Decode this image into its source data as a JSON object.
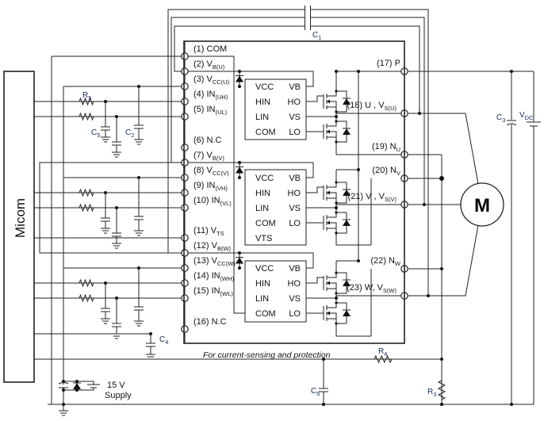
{
  "micom": {
    "label": "Micom"
  },
  "module": {
    "left_pins": [
      {
        "num": "(1)",
        "name": "COM",
        "sub": ""
      },
      {
        "num": "(2)",
        "name": "V",
        "sub": "B(U)"
      },
      {
        "num": "(3)",
        "name": "V",
        "sub": "CC(U)"
      },
      {
        "num": "(4)",
        "name": "IN",
        "sub": "(UH)"
      },
      {
        "num": "(5)",
        "name": "IN",
        "sub": "(UL)"
      },
      {
        "num": "(6)",
        "name": "N.C",
        "sub": ""
      },
      {
        "num": "(7)",
        "name": "V",
        "sub": "B(V)"
      },
      {
        "num": "(8)",
        "name": "V",
        "sub": "CC(V)"
      },
      {
        "num": "(9)",
        "name": "IN",
        "sub": "(VH)"
      },
      {
        "num": "(10)",
        "name": "IN",
        "sub": "(VL)"
      },
      {
        "num": "(11)",
        "name": "V",
        "sub": "TS"
      },
      {
        "num": "(12)",
        "name": "V",
        "sub": "B(W)"
      },
      {
        "num": "(13)",
        "name": "V",
        "sub": "CC(W)"
      },
      {
        "num": "(14)",
        "name": "IN",
        "sub": "(WH)"
      },
      {
        "num": "(15)",
        "name": "IN",
        "sub": "(WL)"
      },
      {
        "num": "(16)",
        "name": "N.C",
        "sub": ""
      }
    ],
    "right_pins": [
      {
        "num": "(17)",
        "name": "P",
        "sub": ""
      },
      {
        "num": "(18)",
        "name": "U , V",
        "sub": "S(U)"
      },
      {
        "num": "(19)",
        "name": "N",
        "sub": "U"
      },
      {
        "num": "(20)",
        "name": "N",
        "sub": "V"
      },
      {
        "num": "(21)",
        "name": "V , V",
        "sub": "S(V)"
      },
      {
        "num": "(22)",
        "name": "N",
        "sub": "W"
      },
      {
        "num": "(23)",
        "name": "W, V",
        "sub": "S(W)"
      }
    ],
    "ics": [
      {
        "left": [
          "VCC",
          "HIN",
          "LIN",
          "COM"
        ],
        "right": [
          "VB",
          "HO",
          "VS",
          "LO"
        ]
      },
      {
        "left": [
          "VCC",
          "HIN",
          "LIN",
          "COM",
          "VTS"
        ],
        "right": [
          "VB",
          "HO",
          "VS",
          "LO"
        ]
      },
      {
        "left": [
          "VCC",
          "HIN",
          "LIN",
          "COM"
        ],
        "right": [
          "VB",
          "HO",
          "VS",
          "LO"
        ]
      }
    ]
  },
  "components": {
    "C1": {
      "main": "C",
      "sub": "1"
    },
    "C2": {
      "main": "C",
      "sub": "2"
    },
    "C3": {
      "main": "C",
      "sub": "3"
    },
    "C4": {
      "main": "C",
      "sub": "4"
    },
    "C5": {
      "main": "C",
      "sub": "5"
    },
    "C6": {
      "main": "C",
      "sub": "6"
    },
    "R3": {
      "main": "R",
      "sub": "3"
    },
    "R4": {
      "main": "R",
      "sub": "4"
    },
    "R5": {
      "main": "R",
      "sub": "5"
    },
    "VDC": {
      "main": "V",
      "sub": "DC"
    },
    "motor": "M",
    "supply_voltage": "15 V",
    "supply_label": "Supply"
  },
  "note": "For current-sensing and protection"
}
